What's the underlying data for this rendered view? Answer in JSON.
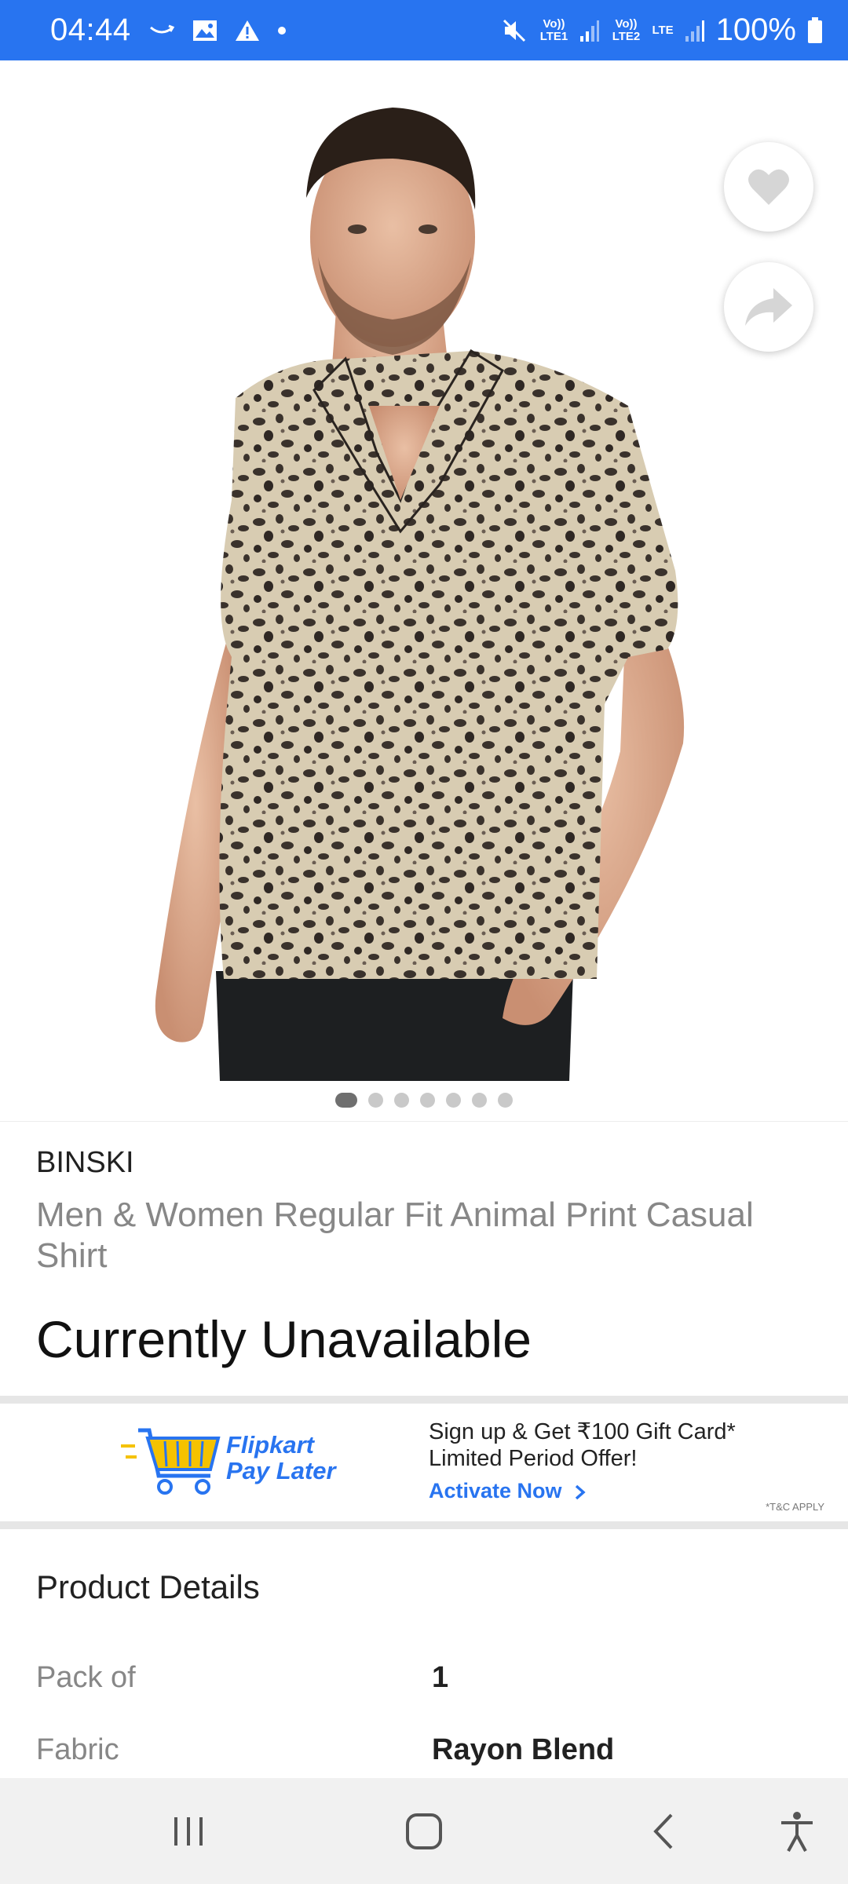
{
  "status_bar": {
    "time": "04:44",
    "sim1_label": "Vo)) LTE1",
    "sim2_label": "Vo)) LTE2",
    "lte_label": "LTE",
    "battery": "100%",
    "icons": [
      "amazon-smile-icon",
      "image-icon",
      "warning-icon",
      "dot-icon",
      "mute-icon",
      "signal-icon",
      "battery-icon"
    ]
  },
  "product": {
    "brand": "BINSKI",
    "title": "Men & Women Regular Fit Animal Print Casual Shirt",
    "availability": "Currently Unavailable",
    "image_count": 7,
    "active_image": 1
  },
  "actions": {
    "wishlist_icon": "heart-icon",
    "share_icon": "share-icon"
  },
  "banner": {
    "brand_line1": "Flipkart",
    "brand_line2": "Pay Later",
    "offer_line1": "Sign up & Get ₹100 Gift Card*",
    "offer_line2": "Limited Period Offer!",
    "cta": "Activate Now",
    "tnc": "*T&C APPLY"
  },
  "details": {
    "heading": "Product Details",
    "specs": [
      {
        "key": "Pack of",
        "value": "1"
      },
      {
        "key": "Fabric",
        "value": "Rayon Blend"
      }
    ]
  },
  "nav": {
    "icons": [
      "recents-icon",
      "home-icon",
      "back-icon",
      "accessibility-icon"
    ]
  },
  "colors": {
    "accent": "#2874f0",
    "cart_yellow": "#f5c200",
    "shirt_base": "#d8ccb2",
    "shirt_spot": "#3a322c"
  }
}
